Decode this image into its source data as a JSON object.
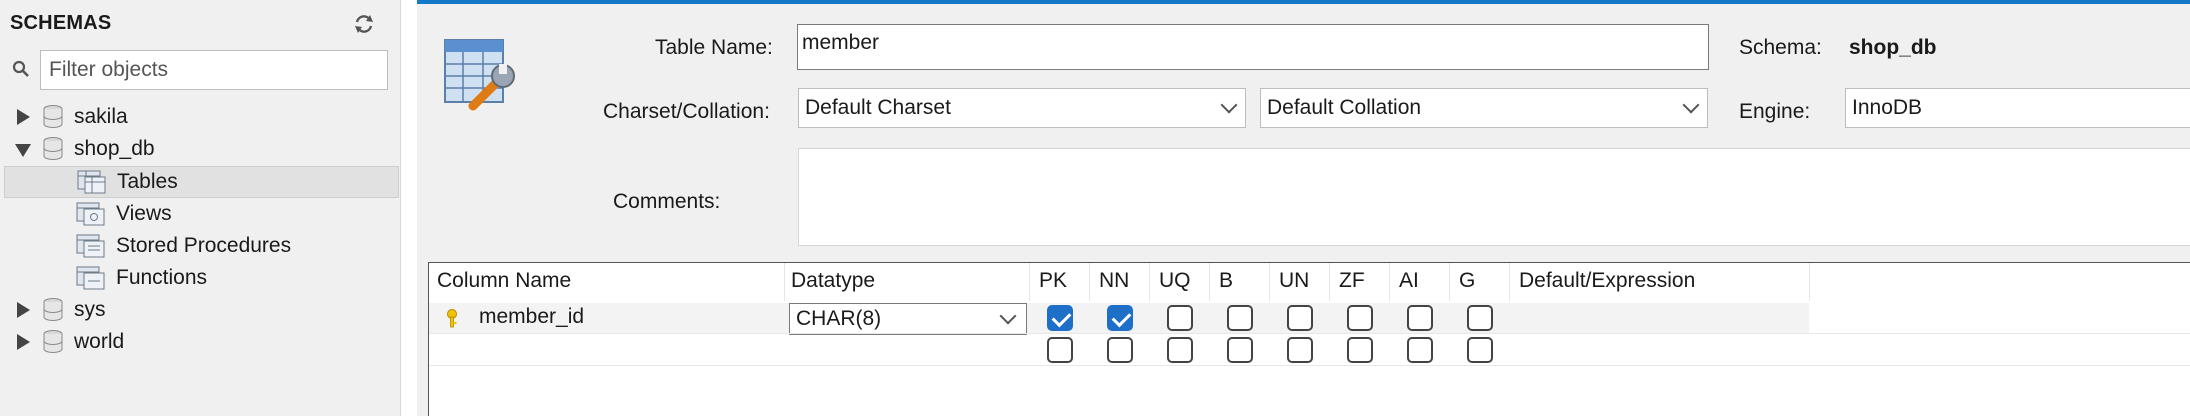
{
  "sidebar": {
    "title": "SCHEMAS",
    "filter_placeholder": "Filter objects",
    "schemas": [
      {
        "name": "sakila",
        "expanded": false
      },
      {
        "name": "shop_db",
        "expanded": true,
        "children": [
          "Tables",
          "Views",
          "Stored Procedures",
          "Functions"
        ],
        "selected_child": "Tables"
      },
      {
        "name": "sys",
        "expanded": false
      },
      {
        "name": "world",
        "expanded": false
      }
    ]
  },
  "editor": {
    "table_name_label": "Table Name:",
    "table_name_value": "member",
    "schema_label": "Schema:",
    "schema_value": "shop_db",
    "charset_label": "Charset/Collation:",
    "charset_value": "Default Charset",
    "collation_value": "Default Collation",
    "engine_label": "Engine:",
    "engine_value": "InnoDB",
    "comments_label": "Comments:",
    "comments_value": ""
  },
  "columns_grid": {
    "headers": [
      "Column Name",
      "Datatype",
      "PK",
      "NN",
      "UQ",
      "B",
      "UN",
      "ZF",
      "AI",
      "G",
      "Default/Expression"
    ],
    "rows": [
      {
        "name": "member_id",
        "datatype": "CHAR(8)",
        "is_key": true,
        "flags": {
          "PK": true,
          "NN": true,
          "UQ": false,
          "B": false,
          "UN": false,
          "ZF": false,
          "AI": false,
          "G": false
        },
        "default": ""
      },
      {
        "name": "",
        "datatype": "",
        "flags": {
          "PK": false,
          "NN": false,
          "UQ": false,
          "B": false,
          "UN": false,
          "ZF": false,
          "AI": false,
          "G": false
        },
        "default": ""
      }
    ]
  },
  "colors": {
    "accent": "#1479c9",
    "checkbox_checked": "#1e6fc7",
    "key_icon": "#f2c200"
  }
}
